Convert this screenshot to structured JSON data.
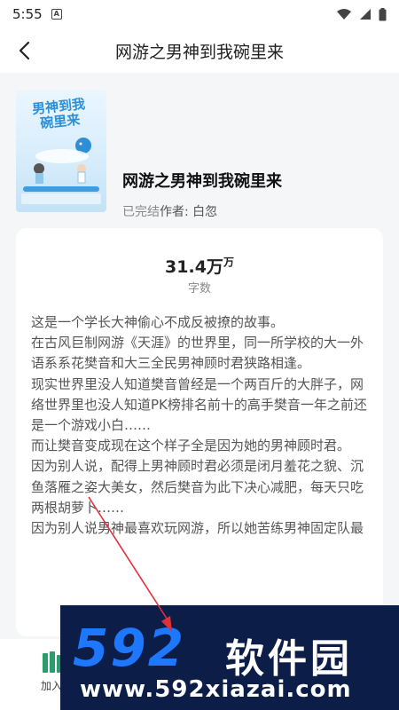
{
  "status_bar": {
    "time": "5:55",
    "app_icon_letter": "A"
  },
  "header": {
    "title": "网游之男神到我碗里来"
  },
  "book": {
    "title": "网游之男神到我碗里来",
    "status": "已完结",
    "author": "作者: 白忽",
    "cover_text": "男神到我碗里来"
  },
  "stats": {
    "word_count": "31.4万",
    "word_count_unit": "万",
    "word_count_label": "字数"
  },
  "synopsis": [
    "这是一个学长大神偷心不成反被撩的故事。",
    "在古风巨制网游《天涯》的世界里，同一所学校的大一外语系系花樊音和大三全民男神顾时君狭路相逢。",
    "现实世界里没人知道樊音曾经是一个两百斤的大胖子，网络世界里也没人知道PK榜排名前十的高手樊音一年之前还是一个游戏小白……",
    "而让樊音变成现在这个样子全是因为她的男神顾时君。",
    "因为别人说，配得上男神顾时君必须是闭月羞花之貌、沉鱼落雁之姿大美女，然后樊音为此下决心减肥，每天只吃两根胡萝卜……",
    "因为别人说男神最喜欢玩网游，所以她苦练男神固定队最"
  ],
  "bottom": {
    "bookshelf_label": "加入"
  },
  "watermark": {
    "logo": "592",
    "brand": "软件园",
    "url": "www.592xiazai.com"
  },
  "colors": {
    "accent": "#1e78ff",
    "watermark_bg": "#0c1e48",
    "arrow": "#e0303a"
  }
}
